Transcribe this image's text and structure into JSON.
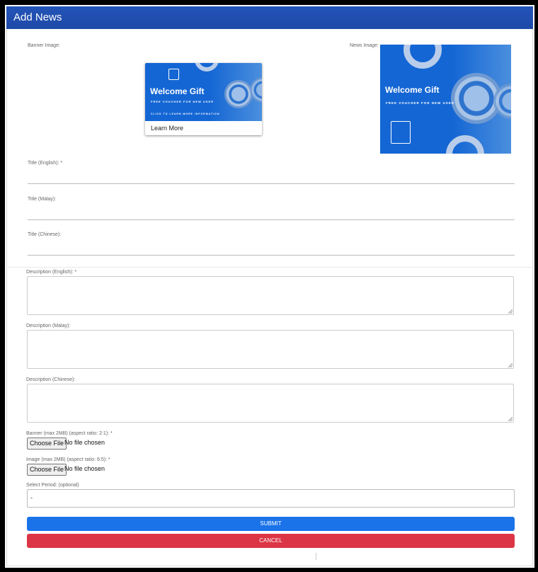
{
  "header": {
    "title": "Add News"
  },
  "labels": {
    "banner_image": "Banner Image:",
    "news_image": "News Image:",
    "title_en": "Title (English): *",
    "title_ms": "Title (Malay):",
    "title_zh": "Title (Chinese):",
    "desc_en": "Description (English): *",
    "desc_ms": "Description (Malay):",
    "desc_zh": "Description (Chinese):",
    "banner_file": "Banner (max 2MB) (aspect ratio: 2:1): *",
    "image_file": "Image (max 2MB) (aspect ratio: 6:5): *",
    "period": "Select Period: (optional)"
  },
  "banner_preview": {
    "heading": "Welcome Gift",
    "subheading": "FREE VOUCHER FOR NEW USER",
    "footnote": "CLICK TO LEARN MORE INFORMATION",
    "link": "Learn More"
  },
  "news_preview": {
    "heading": "Welcome Gift",
    "subheading": "FREE VOUCHER FOR NEW USER"
  },
  "file_inputs": {
    "button_label": "Choose File",
    "banner_status": "No file chosen",
    "image_status": "No file chosen"
  },
  "period_select": {
    "value": "-"
  },
  "buttons": {
    "submit": "SUBMIT",
    "cancel": "CANCEL"
  },
  "colors": {
    "header": "#1e4aa8",
    "submit": "#1a73e8",
    "cancel": "#dc3545",
    "preview_blue": "#1466d4"
  }
}
